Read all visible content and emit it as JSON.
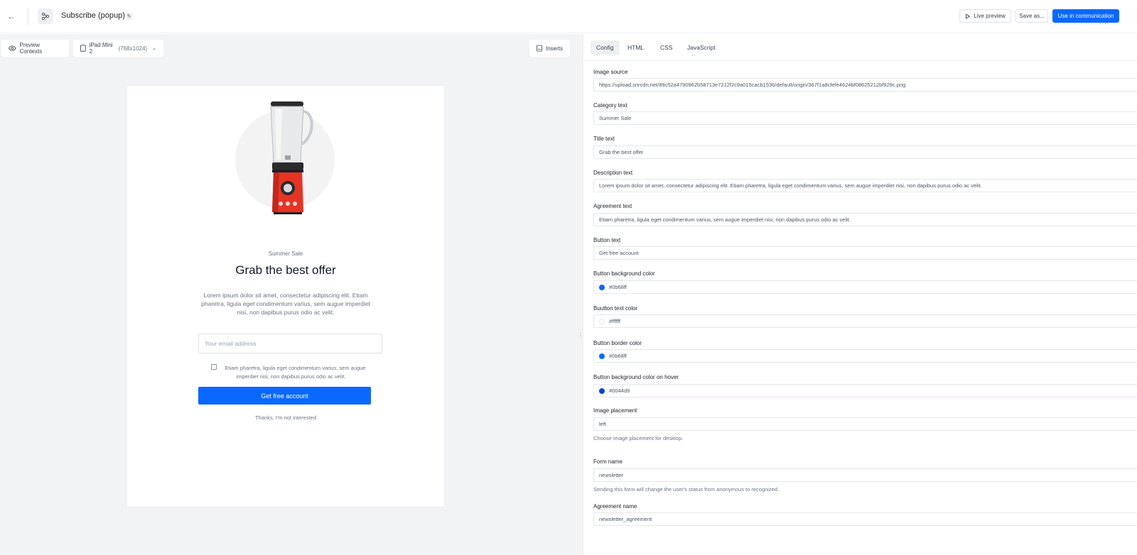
{
  "header": {
    "title": "Subscribe (popup)",
    "live_preview": "Live preview",
    "save_as": "Save as...",
    "use_in_communication": "Use in communication"
  },
  "preview_toolbar": {
    "contexts": "Preview Contexts",
    "device": "iPad Mini 2",
    "device_size": "(768x1024)",
    "inserts": "Inserts"
  },
  "popup": {
    "category": "Summer Sale",
    "title": "Grab the best offer",
    "description": "Lorem ipsum dolor sit amet, consectetur adipiscing elit. Etiam pharetra, ligula eget condimentum varius, sem augue imperdiet nisi, non dapibus purus odio ac velit.",
    "email_placeholder": "Your email address",
    "agreement": "Etiam pharetra, ligula eget condimentum varius, sem augue imperdiet nisi, non dapibus purus odio ac velit.",
    "button": "Get free account",
    "dismiss": "Thanks, I'm not interested"
  },
  "tabs": [
    "Config",
    "HTML",
    "CSS",
    "JavaScript"
  ],
  "config": {
    "image_source": {
      "label": "Image source",
      "value": "https://upload.snrcdn.net/89c52a4790962b58713e7212f2c9a015cacb1536/default/origin/367f1a8cfefe4624bf08625212bf929c.png"
    },
    "category_text": {
      "label": "Category text",
      "value": "Summer Sale"
    },
    "title_text": {
      "label": "Title text",
      "value": "Grab the best offer"
    },
    "description_text": {
      "label": "Description text",
      "value": "Lorem ipsum dolor sit amet, consectetur adipiscing elit. Etiam pharetra, ligula eget condimentum varius, sem augue imperdiet nisi, non dapibus purus odio ac velit."
    },
    "agreement_text": {
      "label": "Agreement text",
      "value": "Etiam pharetra, ligula eget condimentum varius, sem augue imperdiet nisi, non dapibus purus odio ac velit."
    },
    "button_text": {
      "label": "Button text",
      "value": "Get free account"
    },
    "button_bg_color": {
      "label": "Button background color",
      "value": "#0b68ff",
      "swatch": "#0b68ff"
    },
    "button_text_color": {
      "label": "Buutton text color",
      "value": "#ffffff",
      "swatch": "#ffffff"
    },
    "button_border_color": {
      "label": "Button border color",
      "value": "#0b68ff",
      "swatch": "#0b68ff"
    },
    "button_hover_color": {
      "label": "Button background color on hover",
      "value": "#0044d9",
      "swatch": "#0044d9"
    },
    "image_placement": {
      "label": "Image placement",
      "value": "left",
      "help": "Choose image placement for desktop."
    },
    "form_name": {
      "label": "Form name",
      "value": "newsletter",
      "help": "Sending this form will change the user's status from anonymous to recognized."
    },
    "agreement_name": {
      "label": "Agreement name",
      "value": "newsletter_agreement"
    }
  }
}
